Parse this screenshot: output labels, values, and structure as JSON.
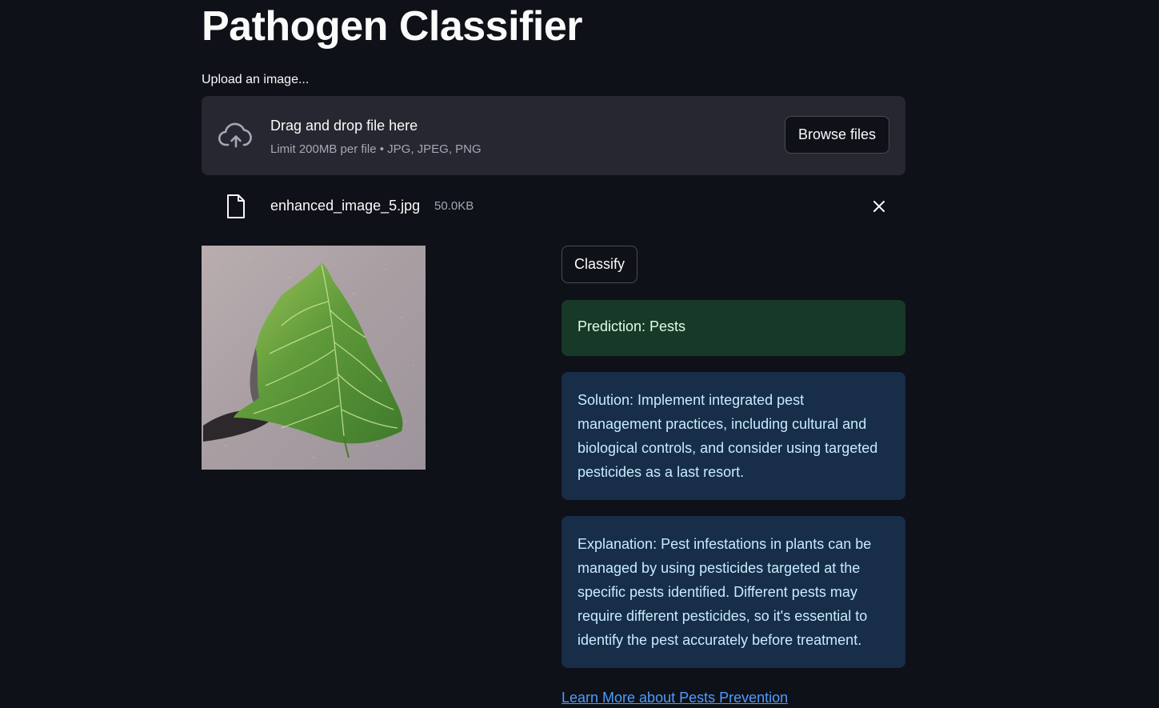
{
  "header": {
    "title": "Pathogen Classifier"
  },
  "uploader": {
    "label": "Upload an image...",
    "drop_text": "Drag and drop file here",
    "limit_text": "Limit 200MB per file • JPG, JPEG, PNG",
    "browse_label": "Browse files"
  },
  "file": {
    "name": "enhanced_image_5.jpg",
    "size": "50.0KB"
  },
  "image": {
    "subject": "green leaf on gray surface"
  },
  "actions": {
    "classify_label": "Classify"
  },
  "results": {
    "prediction": "Prediction: Pests",
    "solution": "Solution: Implement integrated pest management practices, including cultural and biological controls, and consider using targeted pesticides as a last resort.",
    "explanation": "Explanation: Pest infestations in plants can be managed by using pesticides targeted at the specific pests identified. Different pests may require different pesticides, so it's essential to identify the pest accurately before treatment.",
    "link_text": "Learn More about Pests Prevention"
  },
  "icons": {
    "upload": "cloud-upload-icon",
    "file": "file-icon",
    "remove": "close-icon"
  },
  "colors": {
    "background": "#0e1117",
    "dropzone": "#262730",
    "success_bg": "#173928",
    "info_bg": "#172d48",
    "link": "#4d9cff"
  }
}
